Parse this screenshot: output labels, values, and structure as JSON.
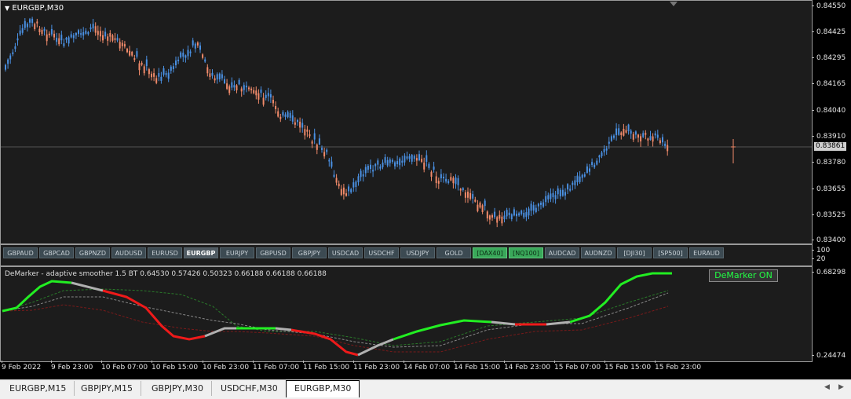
{
  "main_chart": {
    "title": "EURGBP,M30",
    "current_price": "0.83861",
    "price_labels": [
      "0.84550",
      "0.84425",
      "0.84295",
      "0.84165",
      "0.84040",
      "0.83910",
      "0.83780",
      "0.83655",
      "0.83525",
      "0.83400"
    ]
  },
  "symbol_buttons": [
    {
      "label": "GBPAUD",
      "state": "normal"
    },
    {
      "label": "GBPCAD",
      "state": "normal"
    },
    {
      "label": "GBPNZD",
      "state": "normal"
    },
    {
      "label": "AUDUSD",
      "state": "normal"
    },
    {
      "label": "EURUSD",
      "state": "normal"
    },
    {
      "label": "EURGBP",
      "state": "active"
    },
    {
      "label": "EURJPY",
      "state": "normal"
    },
    {
      "label": "GBPUSD",
      "state": "normal"
    },
    {
      "label": "GBPJPY",
      "state": "normal"
    },
    {
      "label": "USDCAD",
      "state": "normal"
    },
    {
      "label": "USDCHF",
      "state": "normal"
    },
    {
      "label": "USDJPY",
      "state": "normal"
    },
    {
      "label": "GOLD",
      "state": "normal"
    },
    {
      "label": "[DAX40]",
      "state": "green"
    },
    {
      "label": "[NQ100]",
      "state": "green"
    },
    {
      "label": "AUDCAD",
      "state": "normal"
    },
    {
      "label": "AUDNZD",
      "state": "normal"
    },
    {
      "label": "[DJI30]",
      "state": "normal"
    },
    {
      "label": "[SP500]",
      "state": "normal"
    },
    {
      "label": "EURAUD",
      "state": "normal"
    }
  ],
  "button_panel_scale": [
    "100",
    "20"
  ],
  "indicator": {
    "title": "DeMarker - adaptive smoother 1.5  BT 0.64530 0.57426 0.50323 0.66188 0.66188 0.66188",
    "badge": "DeMarker ON",
    "top_label": "0.68298",
    "bottom_label": "0.24474"
  },
  "time_labels": [
    "9 Feb 2022",
    "9 Feb 23:00",
    "10 Feb 07:00",
    "10 Feb 15:00",
    "10 Feb 23:00",
    "11 Feb 07:00",
    "11 Feb 15:00",
    "11 Feb 23:00",
    "14 Feb 07:00",
    "14 Feb 15:00",
    "14 Feb 23:00",
    "15 Feb 07:00",
    "15 Feb 15:00",
    "15 Feb 23:00"
  ],
  "tabs": [
    {
      "label": "EURGBP,M15",
      "active": false
    },
    {
      "label": "GBPJPY,M15",
      "active": false
    },
    {
      "label": "GBPJPY,M30",
      "active": false
    },
    {
      "label": "USDCHF,M30",
      "active": false
    },
    {
      "label": "EURGBP,M30",
      "active": true
    }
  ],
  "colors": {
    "bull_candle": "#4a90e2",
    "bear_candle": "#f08a6a",
    "up_line": "#22ee22",
    "down_line": "#ee1a1a",
    "neutral_line": "#b0b0b0",
    "badge_text": "#22ff44"
  }
}
